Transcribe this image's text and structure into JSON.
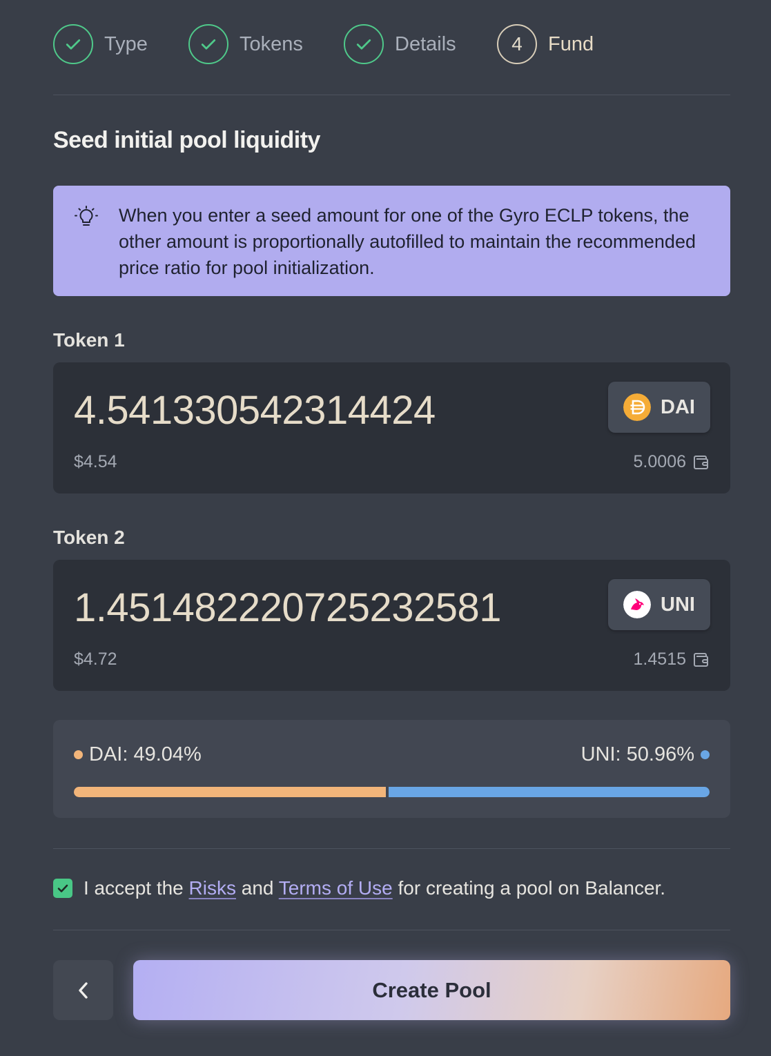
{
  "steps": [
    {
      "label": "Type",
      "status": "done"
    },
    {
      "label": "Tokens",
      "status": "done"
    },
    {
      "label": "Details",
      "status": "done"
    },
    {
      "label": "Fund",
      "number": "4",
      "status": "current"
    }
  ],
  "section_title": "Seed initial pool liquidity",
  "banner": {
    "icon": "lightbulb-icon",
    "text": "When you enter a seed amount for one of the Gyro ECLP tokens, the other amount is proportionally autofilled to maintain the recommended price ratio for pool initialization."
  },
  "tokens": [
    {
      "label": "Token 1",
      "amount": "4.541330542314424",
      "symbol": "DAI",
      "usd": "$4.54",
      "balance": "5.0006",
      "logo_color": "#f5ac37"
    },
    {
      "label": "Token 2",
      "amount": "1.451482220725232581",
      "symbol": "UNI",
      "usd": "$4.72",
      "balance": "1.4515",
      "logo_color": "#ff007a"
    }
  ],
  "weights": {
    "left_label": "DAI: 49.04%",
    "right_label": "UNI: 50.96%",
    "left_fraction": 0.4904,
    "right_fraction": 0.5096,
    "left_color": "#f2b57a",
    "right_color": "#69a6e5"
  },
  "terms": {
    "checked": true,
    "prefix": "I accept the",
    "risks_link": "Risks",
    "and": "and",
    "terms_link": "Terms of Use",
    "suffix": "for creating a pool on Balancer."
  },
  "buttons": {
    "back_icon": "chevron-left-icon",
    "create_label": "Create Pool"
  },
  "colors": {
    "success": "#4fc98a",
    "accent": "#b1acef",
    "background": "#393e48"
  }
}
